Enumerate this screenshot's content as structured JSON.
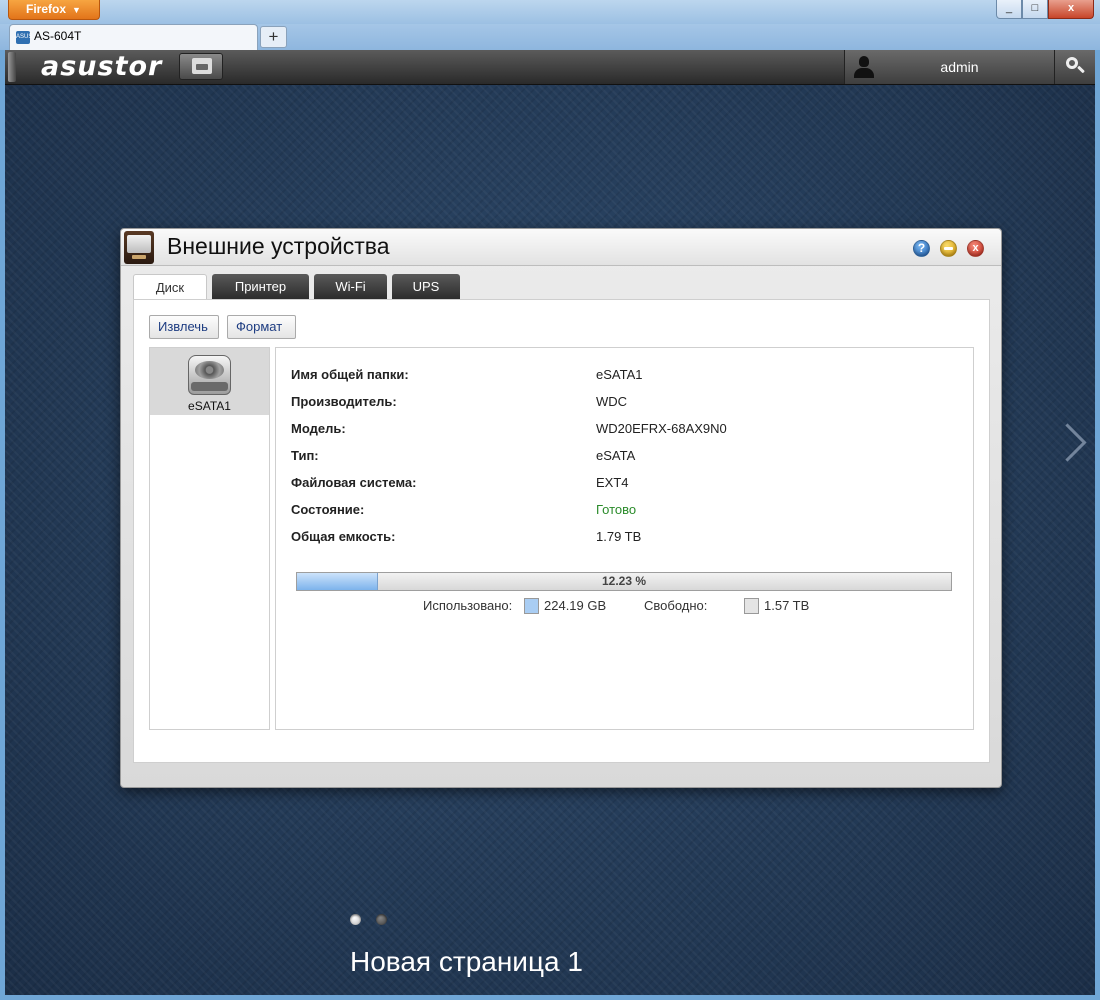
{
  "browser": {
    "menu_label": "Firefox",
    "menu_caret": "▼",
    "tab_title": "AS-604T",
    "favicon_text": "ASUS",
    "newtab_label": "+",
    "window_min": "_",
    "window_max": "□",
    "window_close": "x"
  },
  "topbar": {
    "logo": "asustor",
    "username": "admin",
    "icons": [
      "show-desktop-icon",
      "user-icon",
      "search-icon"
    ]
  },
  "dialog": {
    "title": "Внешние устройства",
    "help_glyph": "?",
    "close_glyph": "x",
    "tabs": [
      {
        "label": "Диск",
        "active": true
      },
      {
        "label": "Принтер",
        "active": false
      },
      {
        "label": "Wi-Fi",
        "active": false
      },
      {
        "label": "UPS",
        "active": false
      }
    ],
    "buttons": {
      "eject": "Извлечь",
      "format": "Формат"
    },
    "devices": [
      {
        "label": "eSATA1",
        "selected": true,
        "icon": "hard-drive-icon"
      }
    ],
    "details": [
      {
        "key": "Имя общей папки:",
        "value": "eSATA1"
      },
      {
        "key": "Производитель:",
        "value": "WDC"
      },
      {
        "key": "Модель:",
        "value": "WD20EFRX-68AX9N0"
      },
      {
        "key": "Тип:",
        "value": "eSATA"
      },
      {
        "key": "Файловая система:",
        "value": "EXT4"
      },
      {
        "key": "Состояние:",
        "value": "Готово"
      },
      {
        "key": "Общая емкость:",
        "value": "1.79 TB"
      }
    ],
    "usage": {
      "percent": 12.23,
      "percent_label": "12.23 %",
      "used_label": "Использовано:",
      "used_value": "224.19 GB",
      "free_label": "Свободно:",
      "free_value": "1.57 TB",
      "used_color": "#a9cdf3",
      "free_color": "#e4e4e4"
    }
  },
  "desktop": {
    "page_name": "Новая страница 1",
    "pages": [
      {
        "active": true
      },
      {
        "active": false
      }
    ]
  },
  "colors": {
    "status_ok": "#2a8b2a",
    "button_text": "#1e3d82",
    "firefox_orange": "#e2741a"
  }
}
